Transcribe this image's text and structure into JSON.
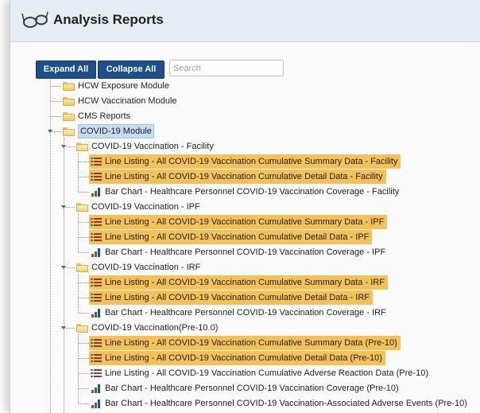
{
  "header": {
    "title": "Analysis Reports",
    "icon": "eyeglasses-icon"
  },
  "toolbar": {
    "expand_all": "Expand All",
    "collapse_all": "Collapse All",
    "search_placeholder": "Search"
  },
  "colors": {
    "highlight": "#f4c257",
    "button": "#1d4f8a",
    "header": "#e7edf5",
    "selected": "#c6dcf3"
  },
  "tree": {
    "top_modules": [
      {
        "label": "HCW Exposure Module"
      },
      {
        "label": "HCW Vaccination Module"
      },
      {
        "label": "CMS Reports"
      },
      {
        "label": "COVID-19 Module"
      }
    ],
    "groups": [
      {
        "label": "COVID-19 Vaccination - Facility",
        "items": [
          {
            "label": "Line Listing - All COVID-19 Vaccination Cumulative Summary Data - Facility",
            "type": "list",
            "highlighted": true
          },
          {
            "label": "Line Listing - All COVID-19 Vaccination Cumulative Detail Data - Facility",
            "type": "list",
            "highlighted": true
          },
          {
            "label": "Bar Chart - Healthcare Personnel COVID-19 Vaccination Coverage - Facility",
            "type": "bar",
            "highlighted": false
          }
        ]
      },
      {
        "label": "COVID-19 Vaccination - IPF",
        "items": [
          {
            "label": "Line Listing - All COVID-19 Vaccination Cumulative Summary Data - IPF",
            "type": "list",
            "highlighted": true
          },
          {
            "label": "Line Listing - All COVID-19 Vaccination Cumulative Detail Data - IPF",
            "type": "list",
            "highlighted": true
          },
          {
            "label": "Bar Chart - Healthcare Personnel COVID-19 Vaccination Coverage - IPF",
            "type": "bar",
            "highlighted": false
          }
        ]
      },
      {
        "label": "COVID-19 Vaccination - IRF",
        "items": [
          {
            "label": "Line Listing - All COVID-19 Vaccination Cumulative Summary Data - IRF",
            "type": "list",
            "highlighted": true
          },
          {
            "label": "Line Listing - All COVID-19 Vaccination Cumulative Detail Data - IRF",
            "type": "list",
            "highlighted": true
          },
          {
            "label": "Bar Chart - Healthcare Personnel COVID-19 Vaccination Coverage - IRF",
            "type": "bar",
            "highlighted": false
          }
        ]
      },
      {
        "label": "COVID-19 Vaccination(Pre-10.0)",
        "items": [
          {
            "label": "Line Listing - All COVID-19 Vaccination Cumulative Summary Data (Pre-10)",
            "type": "list",
            "highlighted": true
          },
          {
            "label": "Line Listing - All COVID-19 Vaccination Cumulative Detail Data (Pre-10)",
            "type": "list",
            "highlighted": true
          },
          {
            "label": "Line Listing - All COVID-19 Vaccination Cumulative Adverse Reaction Data (Pre-10)",
            "type": "list",
            "highlighted": false
          },
          {
            "label": "Bar Chart - Healthcare Personnel COVID-19 Vaccination Coverage (Pre-10)",
            "type": "bar",
            "highlighted": false
          },
          {
            "label": "Bar Chart - Healthcare Personnel COVID-19 Vaccination-Associated Adverse Events (Pre-10)",
            "type": "bar",
            "highlighted": false
          }
        ]
      }
    ]
  }
}
